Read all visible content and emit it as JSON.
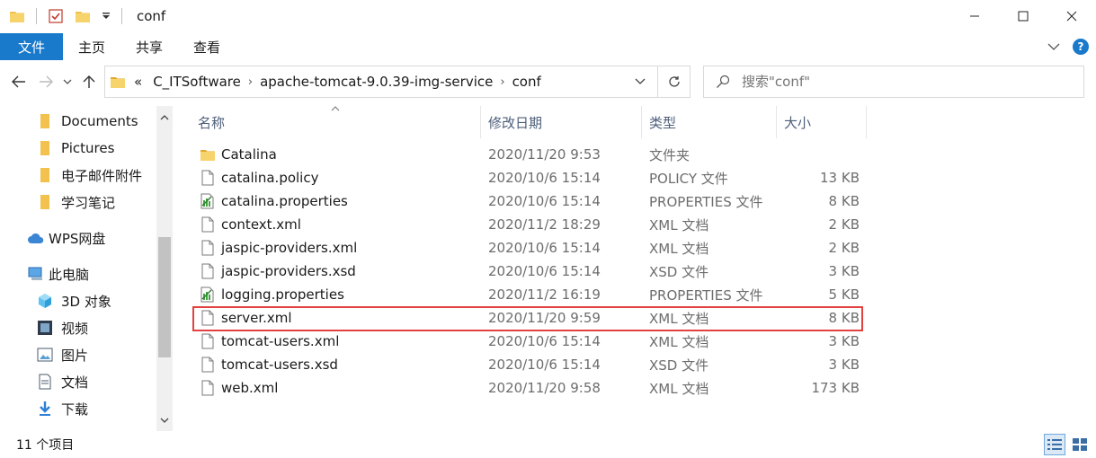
{
  "window": {
    "title": "conf",
    "controls": {
      "minimize": "─",
      "maximize": "☐",
      "close": "✕"
    }
  },
  "ribbon": {
    "tabs": [
      {
        "label": "文件"
      },
      {
        "label": "主页"
      },
      {
        "label": "共享"
      },
      {
        "label": "查看"
      }
    ]
  },
  "address": {
    "overflow": "«",
    "crumbs": [
      "C_ITSoftware",
      "apache-tomcat-9.0.39-img-service",
      "conf"
    ]
  },
  "search": {
    "placeholder": "搜索\"conf\""
  },
  "nav_pane": {
    "items": [
      {
        "label": "Documents",
        "icon": "folder-icon"
      },
      {
        "label": "Pictures",
        "icon": "folder-icon"
      },
      {
        "label": "电子邮件附件",
        "icon": "folder-icon"
      },
      {
        "label": "学习笔记",
        "icon": "folder-icon"
      },
      {
        "label": "WPS网盘",
        "icon": "cloud-icon"
      },
      {
        "label": "此电脑",
        "icon": "computer-icon"
      },
      {
        "label": "3D 对象",
        "icon": "cube-icon"
      },
      {
        "label": "视频",
        "icon": "video-icon"
      },
      {
        "label": "图片",
        "icon": "picture-icon"
      },
      {
        "label": "文档",
        "icon": "document-icon"
      },
      {
        "label": "下载",
        "icon": "download-icon"
      }
    ]
  },
  "columns": {
    "name": "名称",
    "date": "修改日期",
    "type": "类型",
    "size": "大小"
  },
  "files": [
    {
      "name": "Catalina",
      "date": "2020/11/20 9:53",
      "type": "文件夹",
      "size": "",
      "icon": "folder-icon"
    },
    {
      "name": "catalina.policy",
      "date": "2020/10/6 15:14",
      "type": "POLICY 文件",
      "size": "13 KB",
      "icon": "file-icon"
    },
    {
      "name": "catalina.properties",
      "date": "2020/10/6 15:14",
      "type": "PROPERTIES 文件",
      "size": "8 KB",
      "icon": "properties-file-icon"
    },
    {
      "name": "context.xml",
      "date": "2020/11/2 18:29",
      "type": "XML 文档",
      "size": "2 KB",
      "icon": "file-icon"
    },
    {
      "name": "jaspic-providers.xml",
      "date": "2020/10/6 15:14",
      "type": "XML 文档",
      "size": "2 KB",
      "icon": "file-icon"
    },
    {
      "name": "jaspic-providers.xsd",
      "date": "2020/10/6 15:14",
      "type": "XSD 文件",
      "size": "3 KB",
      "icon": "file-icon"
    },
    {
      "name": "logging.properties",
      "date": "2020/11/2 16:19",
      "type": "PROPERTIES 文件",
      "size": "5 KB",
      "icon": "properties-file-icon"
    },
    {
      "name": "server.xml",
      "date": "2020/11/20 9:59",
      "type": "XML 文档",
      "size": "8 KB",
      "icon": "file-icon"
    },
    {
      "name": "tomcat-users.xml",
      "date": "2020/10/6 15:14",
      "type": "XML 文档",
      "size": "3 KB",
      "icon": "file-icon"
    },
    {
      "name": "tomcat-users.xsd",
      "date": "2020/10/6 15:14",
      "type": "XSD 文件",
      "size": "3 KB",
      "icon": "file-icon"
    },
    {
      "name": "web.xml",
      "date": "2020/11/20 9:58",
      "type": "XML 文档",
      "size": "173 KB",
      "icon": "file-icon"
    }
  ],
  "highlighted_file": "server.xml",
  "status": {
    "item_count": "11 个项目"
  },
  "colors": {
    "accent": "#1979ca",
    "highlight_border": "#e34040",
    "folder": "#f2c14e"
  }
}
